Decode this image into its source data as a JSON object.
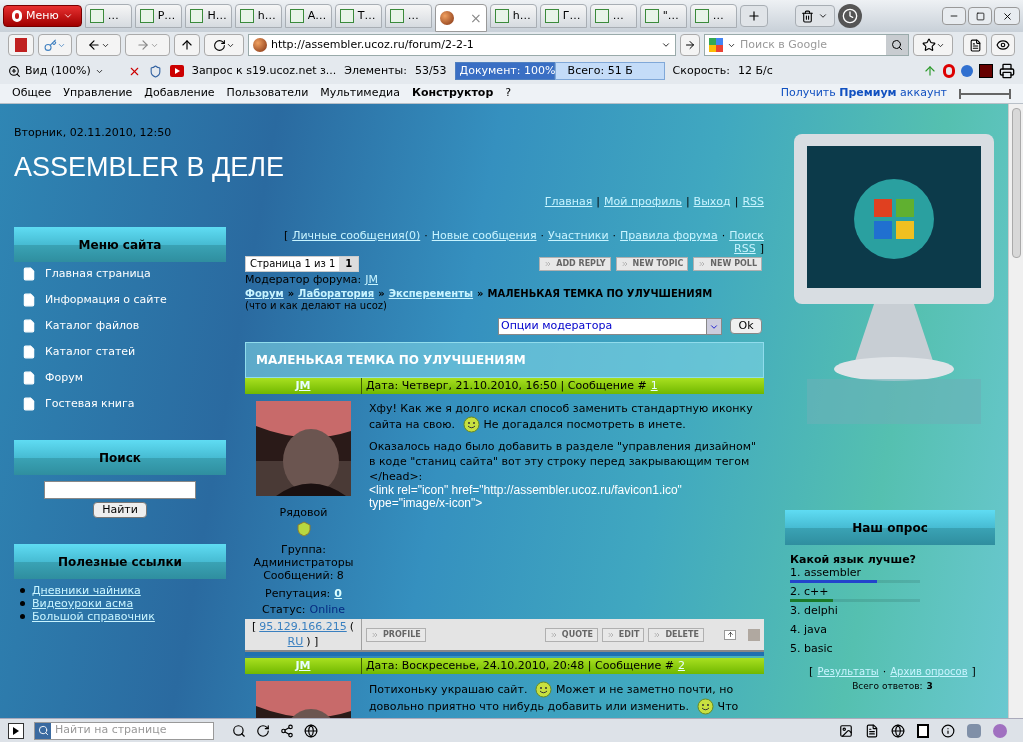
{
  "browser": {
    "menu_button": "Меню",
    "tabs": [
      {
        "label": "…",
        "selected": false
      },
      {
        "label": "P…",
        "selected": false
      },
      {
        "label": "H…",
        "selected": false
      },
      {
        "label": "h…",
        "selected": false
      },
      {
        "label": "A…",
        "selected": false
      },
      {
        "label": "T…",
        "selected": false
      },
      {
        "label": "…",
        "selected": false
      },
      {
        "selected": true,
        "close": "×"
      },
      {
        "label": "h…",
        "selected": false
      },
      {
        "label": "Г…",
        "selected": false
      },
      {
        "label": "…",
        "selected": false
      },
      {
        "label": "\"…",
        "selected": false
      },
      {
        "label": "…",
        "selected": false
      }
    ],
    "address": "http://assembler.ucoz.ru/forum/2-2-1",
    "search_placeholder": "Поиск в Google",
    "status_toolbar": {
      "zoom": "Вид (100%)",
      "request": "Запрос к s19.ucoz.net з...",
      "elements_label": "Элементы:",
      "elements": "53/53",
      "document": {
        "label": "Документ:",
        "value": "100%",
        "level": 1
      },
      "total_label": "Всего:",
      "total": "51 Б",
      "speed_label": "Скорость:",
      "speed": "12 Б/с"
    },
    "menubar": [
      {
        "label": "Общее",
        "selected": false
      },
      {
        "label": "Управление",
        "selected": false
      },
      {
        "label": "Добавление",
        "selected": false
      },
      {
        "label": "Пользователи",
        "selected": false
      },
      {
        "label": "Мультимедиа",
        "selected": false
      },
      {
        "label": "Конструктор",
        "selected": true
      },
      {
        "label": "?",
        "selected": false
      }
    ],
    "premium": "Получить **Премиум** аккаунт",
    "find_placeholder": "Найти на странице"
  },
  "page": {
    "date": "Вторник, 02.11.2010, 12:50",
    "title": "ASSEMBLER В ДЕЛЕ",
    "nav": [
      {
        "label": "Главная"
      },
      {
        "sep": "|",
        "label": "Мой профиль"
      },
      {
        "sep": "|",
        "label": "Выход"
      },
      {
        "sep": "|",
        "label": "RSS"
      }
    ],
    "site_menu": {
      "title": "Меню сайта",
      "items": [
        "Главная страница",
        "Информация о сайте",
        "Каталог файлов",
        "Каталог статей",
        "Форум",
        "Гостевая книга"
      ]
    },
    "search": {
      "title": "Поиск",
      "button": "Найти"
    },
    "useful_links": {
      "title": "Полезные ссылки",
      "items": [
        "Дневники чайника",
        "Видеоуроки асма",
        "Большой справочник"
      ]
    },
    "forum": {
      "links_open": "[",
      "links": [
        {
          "label": "Личные сообщения(0)"
        },
        {
          "sep": "·",
          "label": "Новые сообщения"
        },
        {
          "sep": "·",
          "label": "Участники"
        },
        {
          "sep": "·",
          "label": "Правила форума"
        },
        {
          "sep": "·",
          "label": "Поиск"
        },
        {
          "label": "RSS"
        }
      ],
      "links_close": "]",
      "pager_label": "Страница 1 из 1",
      "pager_page": "1",
      "actions": [
        "ADD REPLY",
        "NEW TOPIC",
        "NEW POLL"
      ],
      "moderator_label": "Модератор форума:",
      "moderator": "JM",
      "breadcrumb": [
        {
          "label": "Форум",
          "sep": "»"
        },
        {
          "label": "Лаборатория",
          "sep": "»"
        },
        {
          "label": "Эксперементы",
          "sep": "»"
        }
      ],
      "current": "МАЛЕНЬКАЯ ТЕМКА ПО УЛУЧШЕНИЯМ",
      "note": "(что и как делают на ucoz)",
      "mod_select": "Опции модератора",
      "ok": "Ok",
      "topic_title": "МАЛЕНЬКАЯ ТЕМКА ПО УЛУЧШЕНИЯМ",
      "posts": [
        {
          "author": "JM",
          "date": "Дата: Четверг, 21.10.2010, 16:50 | Сообщение #",
          "number": "1",
          "rank": "Рядовой",
          "group_label": "Группа:",
          "group": "Администраторы",
          "messages": "Сообщений: 8",
          "reputation_label": "Репутация:",
          "reputation": "0",
          "status_label": "Статус:",
          "status": "Online",
          "ip_open": "[",
          "ip": "95.129.166.215",
          "country_open": "(",
          "country": "RU",
          "ip_close": ") ]",
          "checked": false,
          "paragraphs": [
            [
              {
                "kind": "text",
                "text": "Хфу! Как же я долго искал способ заменить стандартную иконку сайта на свою."
              },
              {
                "kind": "smiley"
              },
              {
                "kind": "text",
                "text": "Не догадался посмотреть в инете."
              }
            ],
            [
              {
                "kind": "text",
                "text": "Оказалось надо было добавить в разделе \"управления дизайном\" в коде \"станиц сайта\" вот эту строку перед закрывающим тегом </head>:"
              },
              {
                "kind": "code",
                "text": "<link rel=\"icon\" href=\"http://assembler.ucoz.ru/favicon1.ico\" type=\"image/x-icon\">"
              }
            ]
          ],
          "buttons": [
            "PROFILE",
            "QUOTE",
            "EDIT",
            "DELETE"
          ]
        },
        {
          "author": "JM",
          "date": "Дата: Воскресенье, 24.10.2010, 20:48 | Сообщение #",
          "number": "2",
          "paragraphs": [
            [
              {
                "kind": "text",
                "text": "Потихоньку украшаю сайт."
              },
              {
                "kind": "smiley"
              },
              {
                "kind": "text",
                "text": "Может и не заметно почти, но довольно приятно что нибудь добавить или изменить."
              },
              {
                "kind": "smiley"
              },
              {
                "kind": "text",
                "text": "Что"
              }
            ]
          ]
        }
      ]
    },
    "poll": {
      "title": "Наш опрос",
      "question": "Какой язык лучше?",
      "options": [
        {
          "label": "1. assembler",
          "level": 0.67,
          "color": "#2244cc"
        },
        {
          "label": "2. c++",
          "level": 0.33,
          "color": "#1a7a2a"
        },
        {
          "label": "3. delphi"
        },
        {
          "label": "4. java"
        },
        {
          "label": "5. basic"
        }
      ],
      "links_open": "[",
      "results": "Результаты",
      "links_sep": "·",
      "archive": "Архив опросов",
      "links_close": "]",
      "total_label": "Всего ответов:",
      "total": "3"
    }
  }
}
